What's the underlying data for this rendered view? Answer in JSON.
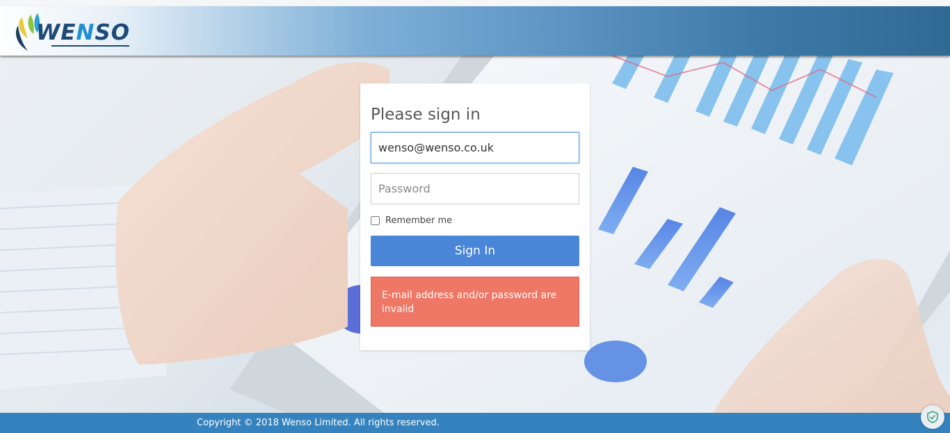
{
  "brand": {
    "name_part1": "WE",
    "name_part2": "N",
    "name_part3": "SO"
  },
  "login": {
    "title": "Please sign in",
    "email_value": "wenso@wenso.co.uk",
    "password_placeholder": "Password",
    "remember_label": "Remember me",
    "submit_label": "Sign In",
    "error_message": "E-mail address and/or password are invalid"
  },
  "footer": {
    "copyright": "Copyright © 2018 Wenso Limited. All rights reserved."
  },
  "icons": {
    "logo": "wenso-leaf-logo",
    "badge": "shield-check-icon"
  },
  "colors": {
    "header_start": "#ffffff",
    "header_end": "#2f6a94",
    "button": "#4a86d8",
    "alert": "#ef7766",
    "footer": "#3583be"
  }
}
